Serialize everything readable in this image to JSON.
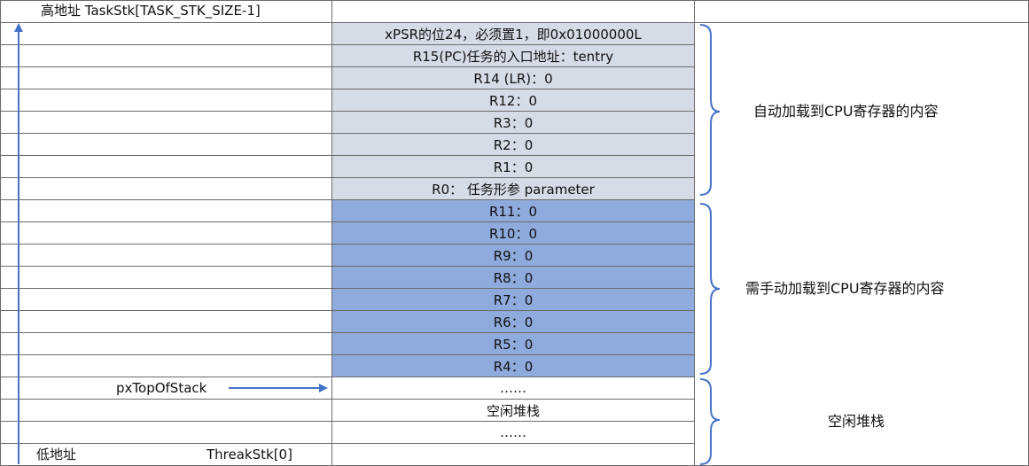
{
  "left_column": {
    "high_address_label": "高地址 TaskStk[TASK_STK_SIZE-1]",
    "pointer_label": "pxTopOfStack",
    "low_address_label": "低地址",
    "base_label": "ThreakStk[0]"
  },
  "stack_rows": [
    {
      "text": "",
      "style": "plain"
    },
    {
      "text": "xPSR的位24，必须置1，即0x01000000L",
      "style": "light"
    },
    {
      "text": "R15(PC)任务的入口地址：tentry",
      "style": "light"
    },
    {
      "text": "R14 (LR)：0",
      "style": "light"
    },
    {
      "text": "R12：0",
      "style": "light"
    },
    {
      "text": "R3：0",
      "style": "light"
    },
    {
      "text": "R2：0",
      "style": "light"
    },
    {
      "text": "R1：0",
      "style": "light"
    },
    {
      "text": "R0： 任务形参 parameter",
      "style": "light"
    },
    {
      "text": "R11：0",
      "style": "blue"
    },
    {
      "text": "R10：0",
      "style": "blue"
    },
    {
      "text": "R9：0",
      "style": "blue"
    },
    {
      "text": "R8：0",
      "style": "blue"
    },
    {
      "text": "R7：0",
      "style": "blue"
    },
    {
      "text": "R6：0",
      "style": "blue"
    },
    {
      "text": "R5：0",
      "style": "blue"
    },
    {
      "text": "R4：0",
      "style": "blue"
    },
    {
      "text": "……",
      "style": "plain"
    },
    {
      "text": "空闲堆栈",
      "style": "plain"
    },
    {
      "text": "……",
      "style": "plain"
    },
    {
      "text": "",
      "style": "plain"
    }
  ],
  "groups": [
    {
      "label": "自动加载到CPU寄存器的内容"
    },
    {
      "label": "需手动加载到CPU寄存器的内容"
    },
    {
      "label": "空闲堆栈"
    }
  ],
  "colors": {
    "light_fill": "#d6dce5",
    "blue_fill": "#8faadc",
    "arrow": "#4472c4",
    "border": "#6b6b6b"
  }
}
